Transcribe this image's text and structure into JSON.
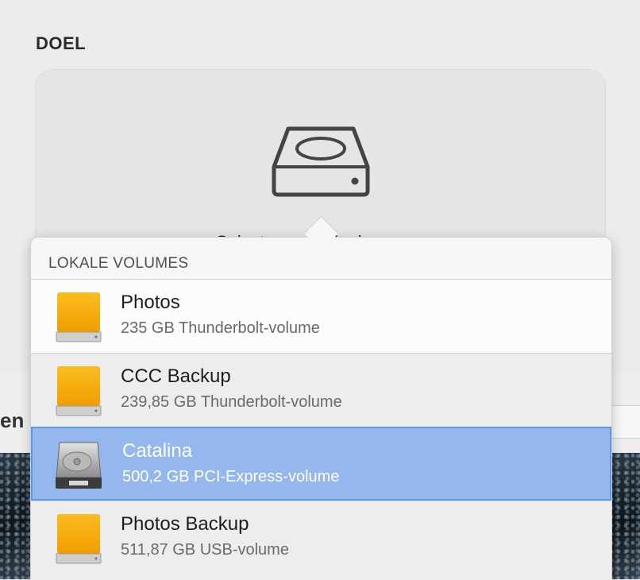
{
  "destination": {
    "section_title": "DOEL",
    "placeholder_label": "Selecteer een doel"
  },
  "background": {
    "partial_label": "en"
  },
  "popover": {
    "header": "LOKALE VOLUMES",
    "volumes": [
      {
        "name": "Photos",
        "detail": "235 GB Thunderbolt-volume",
        "icon": "external-drive-icon",
        "selected": false
      },
      {
        "name": "CCC Backup",
        "detail": "239,85 GB Thunderbolt-volume",
        "icon": "external-drive-icon",
        "selected": false
      },
      {
        "name": "Catalina",
        "detail": "500,2 GB PCI-Express-volume",
        "icon": "internal-hard-drive-icon",
        "selected": true
      },
      {
        "name": "Photos Backup",
        "detail": "511,87 GB USB-volume",
        "icon": "external-drive-icon",
        "selected": false
      }
    ]
  },
  "colors": {
    "selection": "#94b7ee",
    "selection_border": "#5f96e6",
    "drive_orange": "#f6ab0e"
  }
}
